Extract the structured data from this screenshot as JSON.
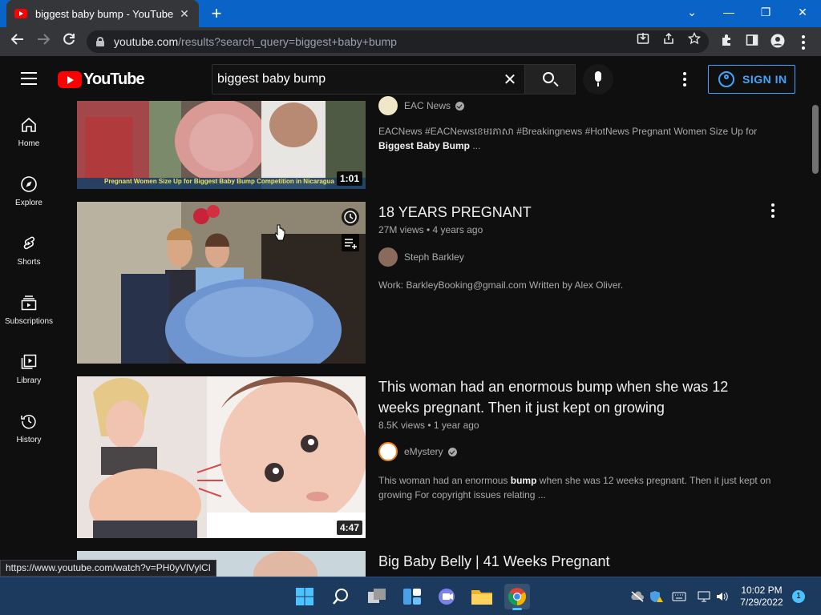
{
  "browser": {
    "tab_title": "biggest baby bump - YouTube",
    "tab_close": "✕",
    "new_tab": "+",
    "window_controls": {
      "minimize": "—",
      "restore": "❐",
      "close": "✕",
      "dropdown": "⌄"
    },
    "url_host": "youtube.com",
    "url_path": "/results?search_query=biggest+baby+bump",
    "status_link": "https://www.youtube.com/watch?v=PH0yVlVylCI"
  },
  "youtube": {
    "logo_text": "YouTube",
    "search_query": "biggest baby bump",
    "clear_symbol": "✕",
    "sign_in_label": "SIGN IN"
  },
  "guide": [
    {
      "label": "Home",
      "icon": "home-icon"
    },
    {
      "label": "Explore",
      "icon": "compass-icon"
    },
    {
      "label": "Shorts",
      "icon": "shorts-icon"
    },
    {
      "label": "Subscriptions",
      "icon": "subscriptions-icon"
    },
    {
      "label": "Library",
      "icon": "library-icon"
    },
    {
      "label": "History",
      "icon": "history-icon"
    }
  ],
  "results": [
    {
      "title": "",
      "meta": "",
      "channel": "EAC News",
      "verified": true,
      "description_prefix": "EACNews #EACNewsខេមរភាសា #Breakingnews #HotNews Pregnant Women Size Up for ",
      "description_bold": "Biggest Baby Bump",
      "description_suffix": " ...",
      "duration": "1:01",
      "thumb_caption": "Pregnant Women Size Up for Biggest Baby Bump Competition in Nicaragua"
    },
    {
      "title": "18 YEARS PREGNANT",
      "meta": "27M views • 4 years ago",
      "channel": "Steph Barkley",
      "verified": false,
      "description": "Work: BarkleyBooking@gmail.com Written by Alex Oliver.",
      "duration": ""
    },
    {
      "title": "This woman had an enormous bump when she was 12 weeks pregnant. Then it just kept on growing",
      "meta": "8.5K views • 1 year ago",
      "channel": "eMystery",
      "verified": true,
      "description_prefix": "This woman had an enormous ",
      "description_bold": "bump",
      "description_suffix": " when she was 12 weeks pregnant. Then it just kept on growing For copyright issues relating ...",
      "duration": "4:47"
    },
    {
      "title": "Big Baby Belly | 41 Weeks Pregnant",
      "meta": "",
      "channel": "",
      "verified": false,
      "description": "",
      "duration": ""
    }
  ],
  "taskbar": {
    "time": "10:02 PM",
    "date": "7/29/2022",
    "notification_count": "1"
  },
  "colors": {
    "accent_blue": "#3ea6ff",
    "youtube_red": "#ff0000",
    "background": "#0f0f0f",
    "chrome_titlebar": "#0a64c8"
  }
}
